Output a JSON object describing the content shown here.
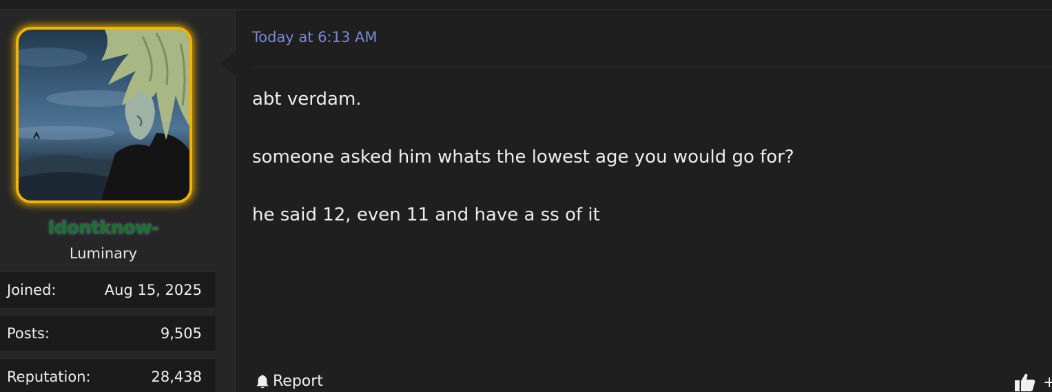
{
  "post": {
    "timestamp": "Today at 6:13 AM",
    "lines": [
      "abt verdam.",
      "someone asked him whats the lowest age you would go for?",
      "he said 12, even 11 and have a ss of it"
    ],
    "report_label": "Report",
    "like_plus": "+"
  },
  "user": {
    "username": "Idontknow-",
    "title": "Luminary",
    "stats": [
      {
        "label": "Joined:",
        "value": "Aug 15, 2025"
      },
      {
        "label": "Posts:",
        "value": "9,505"
      },
      {
        "label": "Reputation:",
        "value": "28,438"
      }
    ]
  },
  "colors": {
    "avatar_frame": "#f2b400",
    "username": "#0f7a1e",
    "timestamp": "#7a88d6",
    "background": "#1f1f1f"
  },
  "icons": {
    "report": "bell-icon",
    "like": "thumbs-up-icon"
  }
}
